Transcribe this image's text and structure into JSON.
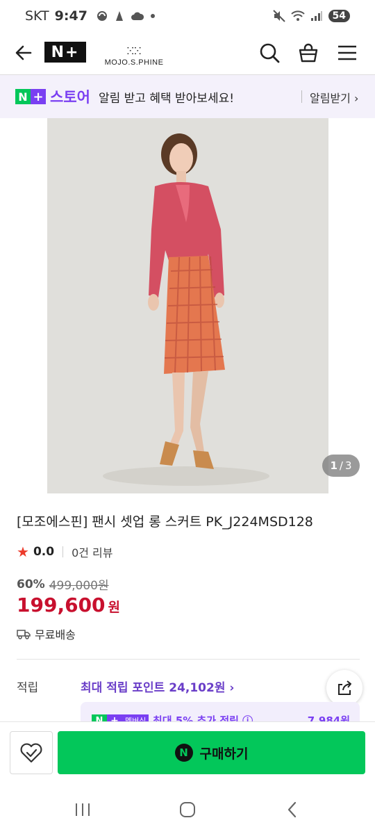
{
  "status_bar": {
    "carrier": "SKT",
    "time": "9:47",
    "battery": "54"
  },
  "header": {
    "nplus_logo": "N+",
    "brand_emblem": "ⵘⵘ",
    "brand_name": "MOJO.S.PHINE"
  },
  "store_banner": {
    "badge_n": "N",
    "badge_plus": "+",
    "store_name": "스토어",
    "message": "알림 받고 혜택 받아보세요!",
    "alarm_label": "알림받기 ›"
  },
  "gallery": {
    "current": "1",
    "separator": "/",
    "total": "3"
  },
  "product": {
    "title": "[모조에스핀] 팬시 셋업 롱 스커트 PK_J224MSD128",
    "rating": "0.0",
    "reviews": "0건 리뷰",
    "discount_pct": "60%",
    "original_price": "499,000원",
    "price": "199,600",
    "price_unit": "원",
    "shipping": "무료배송"
  },
  "points": {
    "label": "적립",
    "value": "최대 적립 포인트 24,102원 ›",
    "member_badge_n": "N",
    "member_badge_plus": "+",
    "member_badge_text": "멤버십",
    "member_label": "최대 5% 추가 적립 ⓘ",
    "member_amount": "7,984원"
  },
  "bottom_bar": {
    "buy_icon": "N",
    "buy_label": "구매하기"
  },
  "colors": {
    "naver_green": "#03c75a",
    "store_purple": "#7a3ff2",
    "price_red": "#c8102e",
    "star_red": "#ec3b2b"
  }
}
